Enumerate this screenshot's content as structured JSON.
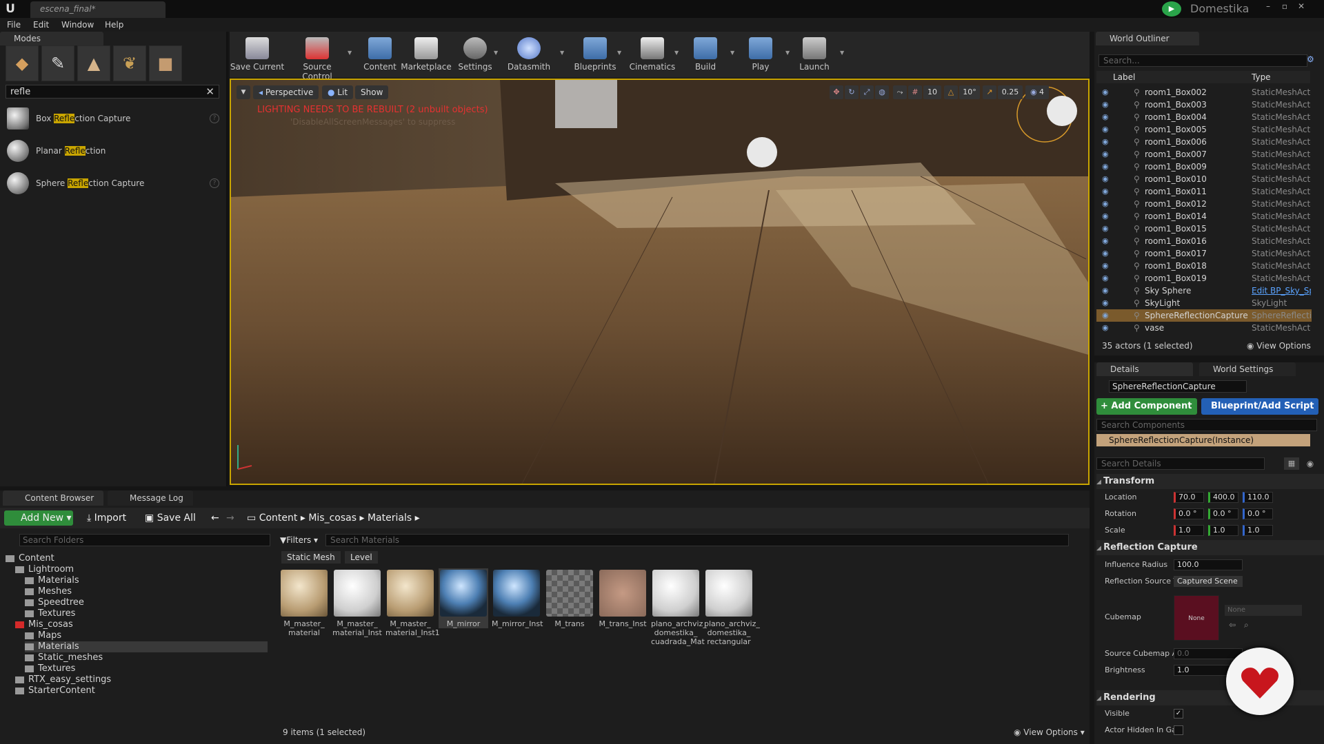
{
  "title_bar": {
    "doc_tab": "escena_final*",
    "brand": "Domestika"
  },
  "menu": [
    "File",
    "Edit",
    "Window",
    "Help"
  ],
  "modes": {
    "tab": "Modes",
    "search_value": "refle",
    "results": [
      {
        "pre": "Box ",
        "match": "Refle",
        "post": "ction Capture"
      },
      {
        "pre": "Planar ",
        "match": "Refle",
        "post": "ction"
      },
      {
        "pre": "Sphere ",
        "match": "Refle",
        "post": "ction Capture"
      }
    ]
  },
  "toolbar": [
    "Save Current",
    "Source Control",
    "Content",
    "Marketplace",
    "Settings",
    "Datasmith",
    "Blueprints",
    "Cinematics",
    "Build",
    "Play",
    "Launch"
  ],
  "viewport": {
    "perspective": "Perspective",
    "lit": "Lit",
    "show": "Show",
    "warning": "LIGHTING NEEDS TO BE REBUILT (2 unbuilt objects)",
    "subwarning": "'DisableAllScreenMessages' to suppress",
    "grid": "10",
    "angle": "10°",
    "scale": "0.25",
    "cam_speed": "4"
  },
  "outliner": {
    "tab": "World Outliner",
    "search_placeholder": "Search...",
    "col_label": "Label",
    "col_type": "Type",
    "rows": [
      {
        "label": "room1_Box002",
        "type": "StaticMeshActor"
      },
      {
        "label": "room1_Box003",
        "type": "StaticMeshActor"
      },
      {
        "label": "room1_Box004",
        "type": "StaticMeshActor"
      },
      {
        "label": "room1_Box005",
        "type": "StaticMeshActor"
      },
      {
        "label": "room1_Box006",
        "type": "StaticMeshActor"
      },
      {
        "label": "room1_Box007",
        "type": "StaticMeshActor"
      },
      {
        "label": "room1_Box009",
        "type": "StaticMeshActor"
      },
      {
        "label": "room1_Box010",
        "type": "StaticMeshActor"
      },
      {
        "label": "room1_Box011",
        "type": "StaticMeshActor"
      },
      {
        "label": "room1_Box012",
        "type": "StaticMeshActor"
      },
      {
        "label": "room1_Box014",
        "type": "StaticMeshActor"
      },
      {
        "label": "room1_Box015",
        "type": "StaticMeshActor"
      },
      {
        "label": "room1_Box016",
        "type": "StaticMeshActor"
      },
      {
        "label": "room1_Box017",
        "type": "StaticMeshActor"
      },
      {
        "label": "room1_Box018",
        "type": "StaticMeshActor"
      },
      {
        "label": "room1_Box019",
        "type": "StaticMeshActor"
      },
      {
        "label": "Sky Sphere",
        "type": "Edit BP_Sky_Sphere"
      },
      {
        "label": "SkyLight",
        "type": "SkyLight"
      },
      {
        "label": "SphereReflectionCapture",
        "type": "SphereReflectionCapture"
      },
      {
        "label": "vase",
        "type": "StaticMeshActor"
      }
    ],
    "status": "35 actors (1 selected)",
    "view_options": "View Options"
  },
  "details": {
    "tab": "Details",
    "tab2": "World Settings",
    "actor_name": "SphereReflectionCapture",
    "add_component": "+ Add Component",
    "blueprint": "Blueprint/Add Script",
    "search_components": "Search Components",
    "component": "SphereReflectionCapture(Instance)",
    "search_details": "Search Details",
    "transform": "Transform",
    "location_label": "Location",
    "rotation_label": "Rotation",
    "scale_label": "Scale",
    "location": [
      "70.0",
      "400.0",
      "110.0"
    ],
    "rotation": [
      "0.0 °",
      "0.0 °",
      "0.0 °"
    ],
    "scale": [
      "1.0",
      "1.0",
      "1.0"
    ],
    "reflection_capture": "Reflection Capture",
    "influence_radius_label": "Influence Radius",
    "influence_radius": "100.0",
    "reflection_source_label": "Reflection Source T",
    "reflection_source": "Captured Scene",
    "cubemap_label": "Cubemap",
    "cubemap_value": "None",
    "cubemap_dropdown": "None",
    "source_cubemap_label": "Source Cubemap A",
    "source_cubemap": "0.0",
    "brightness_label": "Brightness",
    "brightness": "1.0",
    "rendering": "Rendering",
    "visible_label": "Visible",
    "hidden_label": "Actor Hidden In Ga"
  },
  "content_browser": {
    "tab": "Content Browser",
    "tab2": "Message Log",
    "add_new": "Add New",
    "import": "Import",
    "save_all": "Save All",
    "breadcrumb": [
      "Content",
      "Mis_cosas",
      "Materials"
    ],
    "search_folders": "Search Folders",
    "filters": "Filters",
    "search_materials": "Search Materials",
    "filter_chips": [
      "Static Mesh",
      "Level"
    ],
    "folders": [
      {
        "name": "Content",
        "indent": 0
      },
      {
        "name": "Lightroom",
        "indent": 1
      },
      {
        "name": "Materials",
        "indent": 2
      },
      {
        "name": "Meshes",
        "indent": 2
      },
      {
        "name": "Speedtree",
        "indent": 2
      },
      {
        "name": "Textures",
        "indent": 2
      },
      {
        "name": "Mis_cosas",
        "indent": 1
      },
      {
        "name": "Maps",
        "indent": 2
      },
      {
        "name": "Materials",
        "indent": 2
      },
      {
        "name": "Static_meshes",
        "indent": 2
      },
      {
        "name": "Textures",
        "indent": 2
      },
      {
        "name": "RTX_easy_settings",
        "indent": 1
      },
      {
        "name": "StarterContent",
        "indent": 1
      }
    ],
    "assets": [
      {
        "name": "M_master_ material",
        "kind": "cork"
      },
      {
        "name": "M_master_ material_Inst",
        "kind": "white"
      },
      {
        "name": "M_master_ material_Inst1",
        "kind": "cork"
      },
      {
        "name": "M_mirror",
        "kind": "mirror"
      },
      {
        "name": "M_mirror_Inst",
        "kind": "mirror"
      },
      {
        "name": "M_trans",
        "kind": "checker"
      },
      {
        "name": "M_trans_Inst",
        "kind": "checker2"
      },
      {
        "name": "plano_archviz_ domestika_ cuadrada_Mat",
        "kind": "white"
      },
      {
        "name": "plano_archviz_ domestika_ rectangular",
        "kind": "white"
      }
    ],
    "status": "9 items (1 selected)",
    "view_options": "View Options"
  }
}
